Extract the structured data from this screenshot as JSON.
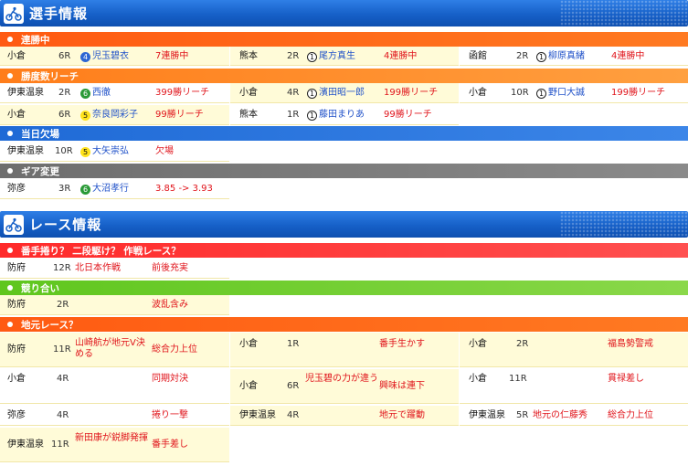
{
  "senshu": {
    "title": "選手情報",
    "renshou": {
      "label": "連勝中",
      "rows": [
        {
          "venue": "小倉",
          "race": "6R",
          "badge": "4",
          "player": "児玉碧衣",
          "info": "7連勝中"
        },
        {
          "venue": "熊本",
          "race": "2R",
          "badge": "1",
          "player": "尾方真生",
          "info": "4連勝中"
        },
        {
          "venue": "函館",
          "race": "2R",
          "badge": "1",
          "player": "柳原真緒",
          "info": "4連勝中"
        }
      ]
    },
    "reach": {
      "label": "勝度数リーチ",
      "rows": [
        {
          "venue": "伊東温泉",
          "race": "2R",
          "badge": "6",
          "player": "西徹",
          "info": "399勝リーチ"
        },
        {
          "venue": "小倉",
          "race": "4R",
          "badge": "1",
          "player": "濱田昭一郎",
          "info": "199勝リーチ"
        },
        {
          "venue": "小倉",
          "race": "10R",
          "badge": "1",
          "player": "野口大誠",
          "info": "199勝リーチ"
        },
        {
          "venue": "小倉",
          "race": "6R",
          "badge": "5",
          "player": "奈良岡彩子",
          "info": "99勝リーチ"
        },
        {
          "venue": "熊本",
          "race": "1R",
          "badge": "1",
          "player": "藤田まりあ",
          "info": "99勝リーチ"
        }
      ]
    },
    "kekka": {
      "label": "当日欠場",
      "rows": [
        {
          "venue": "伊東温泉",
          "race": "10R",
          "badge": "5",
          "player": "大矢崇弘",
          "info": "欠場"
        }
      ]
    },
    "gear": {
      "label": "ギア変更",
      "rows": [
        {
          "venue": "弥彦",
          "race": "3R",
          "badge": "6",
          "player": "大沼孝行",
          "info": "3.85 -> 3.93"
        }
      ]
    }
  },
  "race": {
    "title": "レース情報",
    "banteori": {
      "label": "番手捲り？ 二段駆け？ 作戦レース？",
      "rows": [
        {
          "venue": "防府",
          "race": "12R",
          "col3": "北日本作戦",
          "info": "前後充実"
        }
      ]
    },
    "seriai": {
      "label": "競り合い",
      "rows": [
        {
          "venue": "防府",
          "race": "2R",
          "col3": "",
          "info": "波乱含み"
        }
      ]
    },
    "jimoto": {
      "label": "地元レース？",
      "rows": [
        {
          "venue": "防府",
          "race": "11R",
          "col3": "山崎航が地元V決める",
          "info": "総合力上位"
        },
        {
          "venue": "小倉",
          "race": "1R",
          "col3": "",
          "info": "番手生かす"
        },
        {
          "venue": "小倉",
          "race": "2R",
          "col3": "",
          "info": "福島勢警戒"
        },
        {
          "venue": "小倉",
          "race": "4R",
          "col3": "",
          "info": "同期対決"
        },
        {
          "venue": "小倉",
          "race": "6R",
          "col3": "児玉碧の力が違う",
          "info": "興味は連下"
        },
        {
          "venue": "小倉",
          "race": "11R",
          "col3": "",
          "info": "貫禄差し"
        },
        {
          "venue": "弥彦",
          "race": "4R",
          "col3": "",
          "info": "捲り一撃"
        },
        {
          "venue": "伊東温泉",
          "race": "4R",
          "col3": "",
          "info": "地元で躍動"
        },
        {
          "venue": "伊東温泉",
          "race": "5R",
          "col3": "地元の仁藤秀",
          "info": "総合力上位"
        },
        {
          "venue": "伊東温泉",
          "race": "11R",
          "col3": "新田康が鋭脚発揮",
          "info": "番手差し"
        }
      ]
    }
  }
}
